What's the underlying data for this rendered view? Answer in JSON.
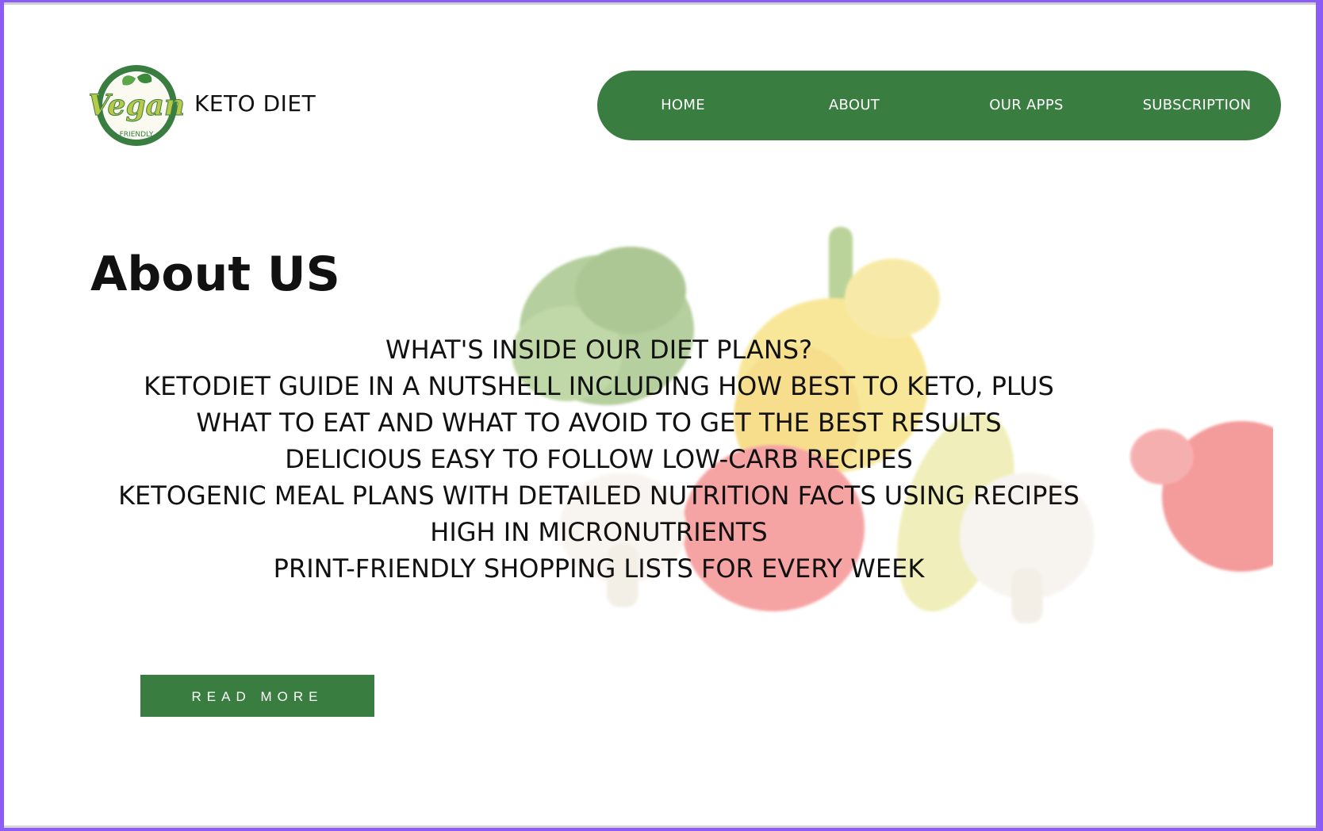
{
  "header": {
    "logo": {
      "name": "vegan-friendly-logo",
      "text_main": "Vegan",
      "text_ribbon": "FRIENDLY"
    },
    "brand": "KETO DIET"
  },
  "nav": {
    "items": [
      {
        "label": "HOME"
      },
      {
        "label": "ABOUT"
      },
      {
        "label": "OUR APPS"
      },
      {
        "label": "SUBSCRIPTION"
      }
    ],
    "color": "#3a7d40"
  },
  "main": {
    "title": "About US",
    "lines": [
      "WHAT'S INSIDE OUR DIET PLANS?",
      "KETODIET GUIDE IN A NUTSHELL INCLUDING HOW BEST TO KETO, PLUS",
      "WHAT TO EAT AND WHAT TO AVOID TO GET THE BEST RESULTS",
      "DELICIOUS EASY TO FOLLOW LOW-CARB RECIPES",
      "KETOGENIC MEAL PLANS WITH DETAILED NUTRITION FACTS USING RECIPES",
      "HIGH IN MICRONUTRIENTS",
      "PRINT-FRIENDLY SHOPPING LISTS FOR EVERY WEEK"
    ],
    "read_more": "READ MORE"
  },
  "hero_image": "vegetables-image"
}
